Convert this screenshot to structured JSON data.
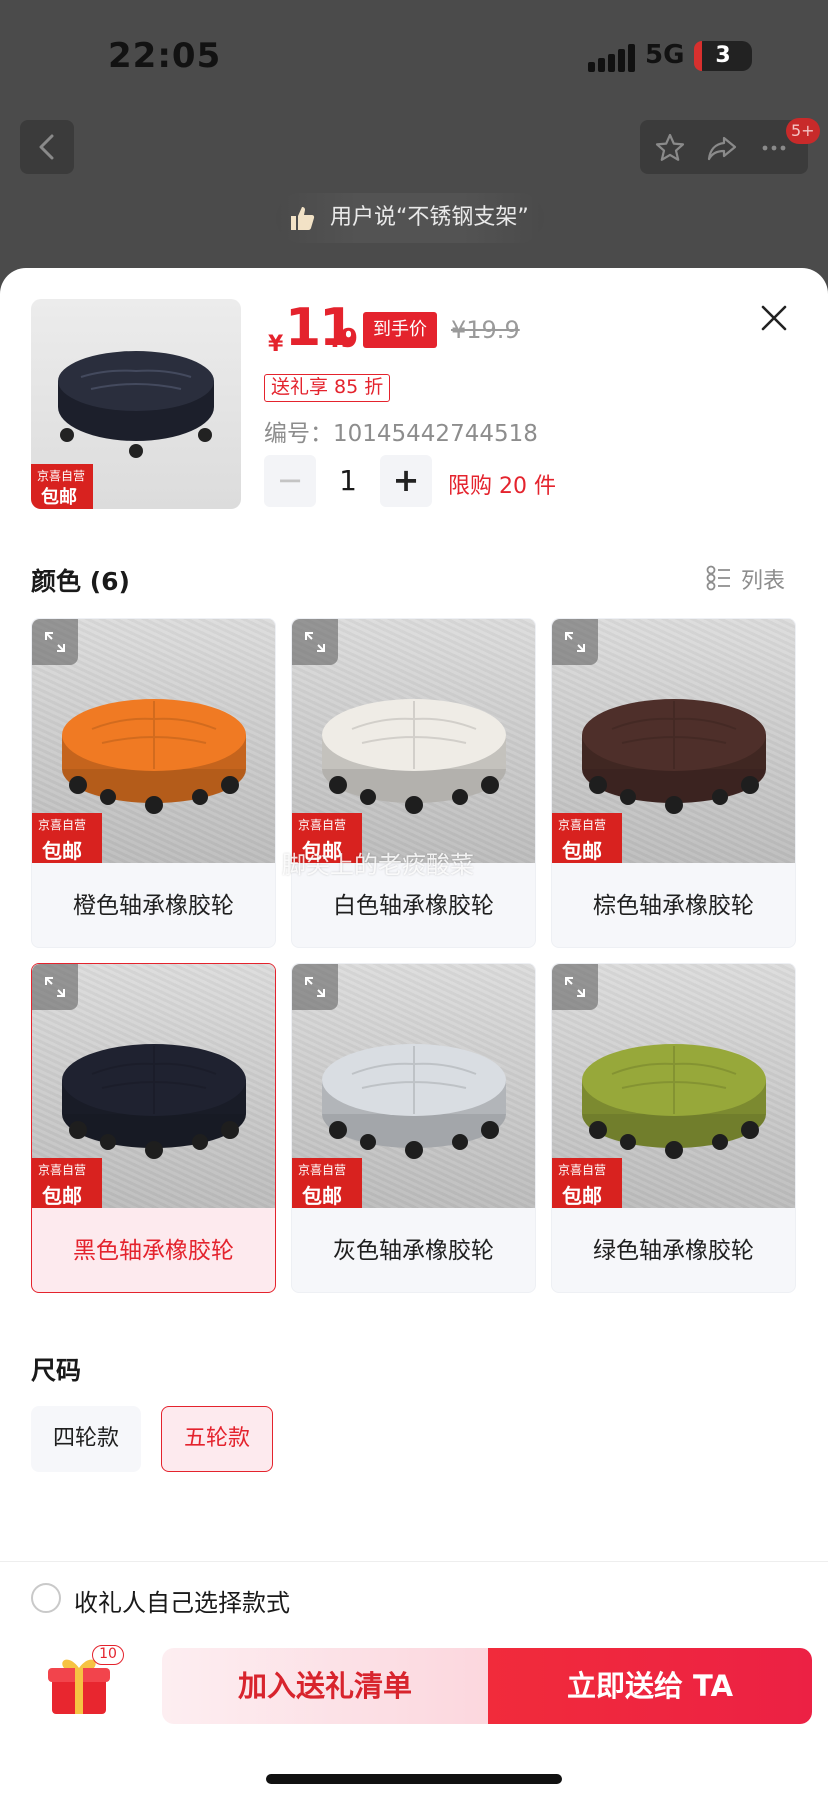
{
  "status_bar": {
    "time": "22:05",
    "network": "5G",
    "battery": "3"
  },
  "nav": {
    "cart_badge": "5+"
  },
  "user_quote": "用户说“不锈钢支架”",
  "product": {
    "price_symbol": "¥",
    "price_integer": "11",
    "price_decimal": ".9",
    "price_tag": "到手价",
    "original_price": "¥19.9",
    "discount_tag": "送礼享 85 折",
    "sku_number": "编号：10145442744518",
    "quantity": "1",
    "qty_minus": "−",
    "qty_plus": "+",
    "limit_text": "限购 20 件",
    "badge_line1": "京喜自营",
    "badge_line2": "包邮"
  },
  "color_section": {
    "title": "颜色 (6)",
    "list_label": "列表",
    "variants": [
      {
        "label": "橙色轴承橡胶轮",
        "color": "#f07a23",
        "selected": false
      },
      {
        "label": "白色轴承橡胶轮",
        "color": "#efece6",
        "selected": false
      },
      {
        "label": "棕色轴承橡胶轮",
        "color": "#4e2f2a",
        "selected": false
      },
      {
        "label": "黑色轴承橡胶轮",
        "color": "#1f2230",
        "selected": true
      },
      {
        "label": "灰色轴承橡胶轮",
        "color": "#d9dde2",
        "selected": false
      },
      {
        "label": "绿色轴承橡胶轮",
        "color": "#97a83a",
        "selected": false
      }
    ],
    "badge_line1": "京喜自营",
    "badge_line2": "包邮",
    "watermark": "脚尖上的老痰酸菜"
  },
  "size_section": {
    "title": "尺码",
    "options": [
      {
        "label": "四轮款",
        "selected": false
      },
      {
        "label": "五轮款",
        "selected": true
      }
    ]
  },
  "recipient_option": "收礼人自己选择款式",
  "bottom_bar": {
    "gift_count": "10",
    "add_to_list": "加入送礼清单",
    "send_now": "立即送给 TA"
  },
  "colors": {
    "accent": "#e4232d",
    "selected_bg": "#fdeaee"
  }
}
